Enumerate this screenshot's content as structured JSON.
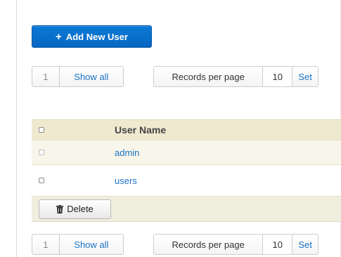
{
  "toolbar": {
    "add_user_label": "Add New User"
  },
  "pagination": {
    "current_page": "1",
    "show_all_label": "Show all"
  },
  "records_per_page": {
    "label": "Records per page",
    "value": "10",
    "set_label": "Set"
  },
  "table": {
    "header": {
      "user_name": "User Name"
    },
    "rows": [
      {
        "user_name": "admin"
      },
      {
        "user_name": "users"
      }
    ],
    "delete_label": "Delete"
  },
  "icons": {
    "add": "plus-icon",
    "delete": "trash-icon"
  },
  "colors": {
    "primary": "#0766c2",
    "link": "#1a73c4",
    "table_header": "#efe9d0"
  }
}
